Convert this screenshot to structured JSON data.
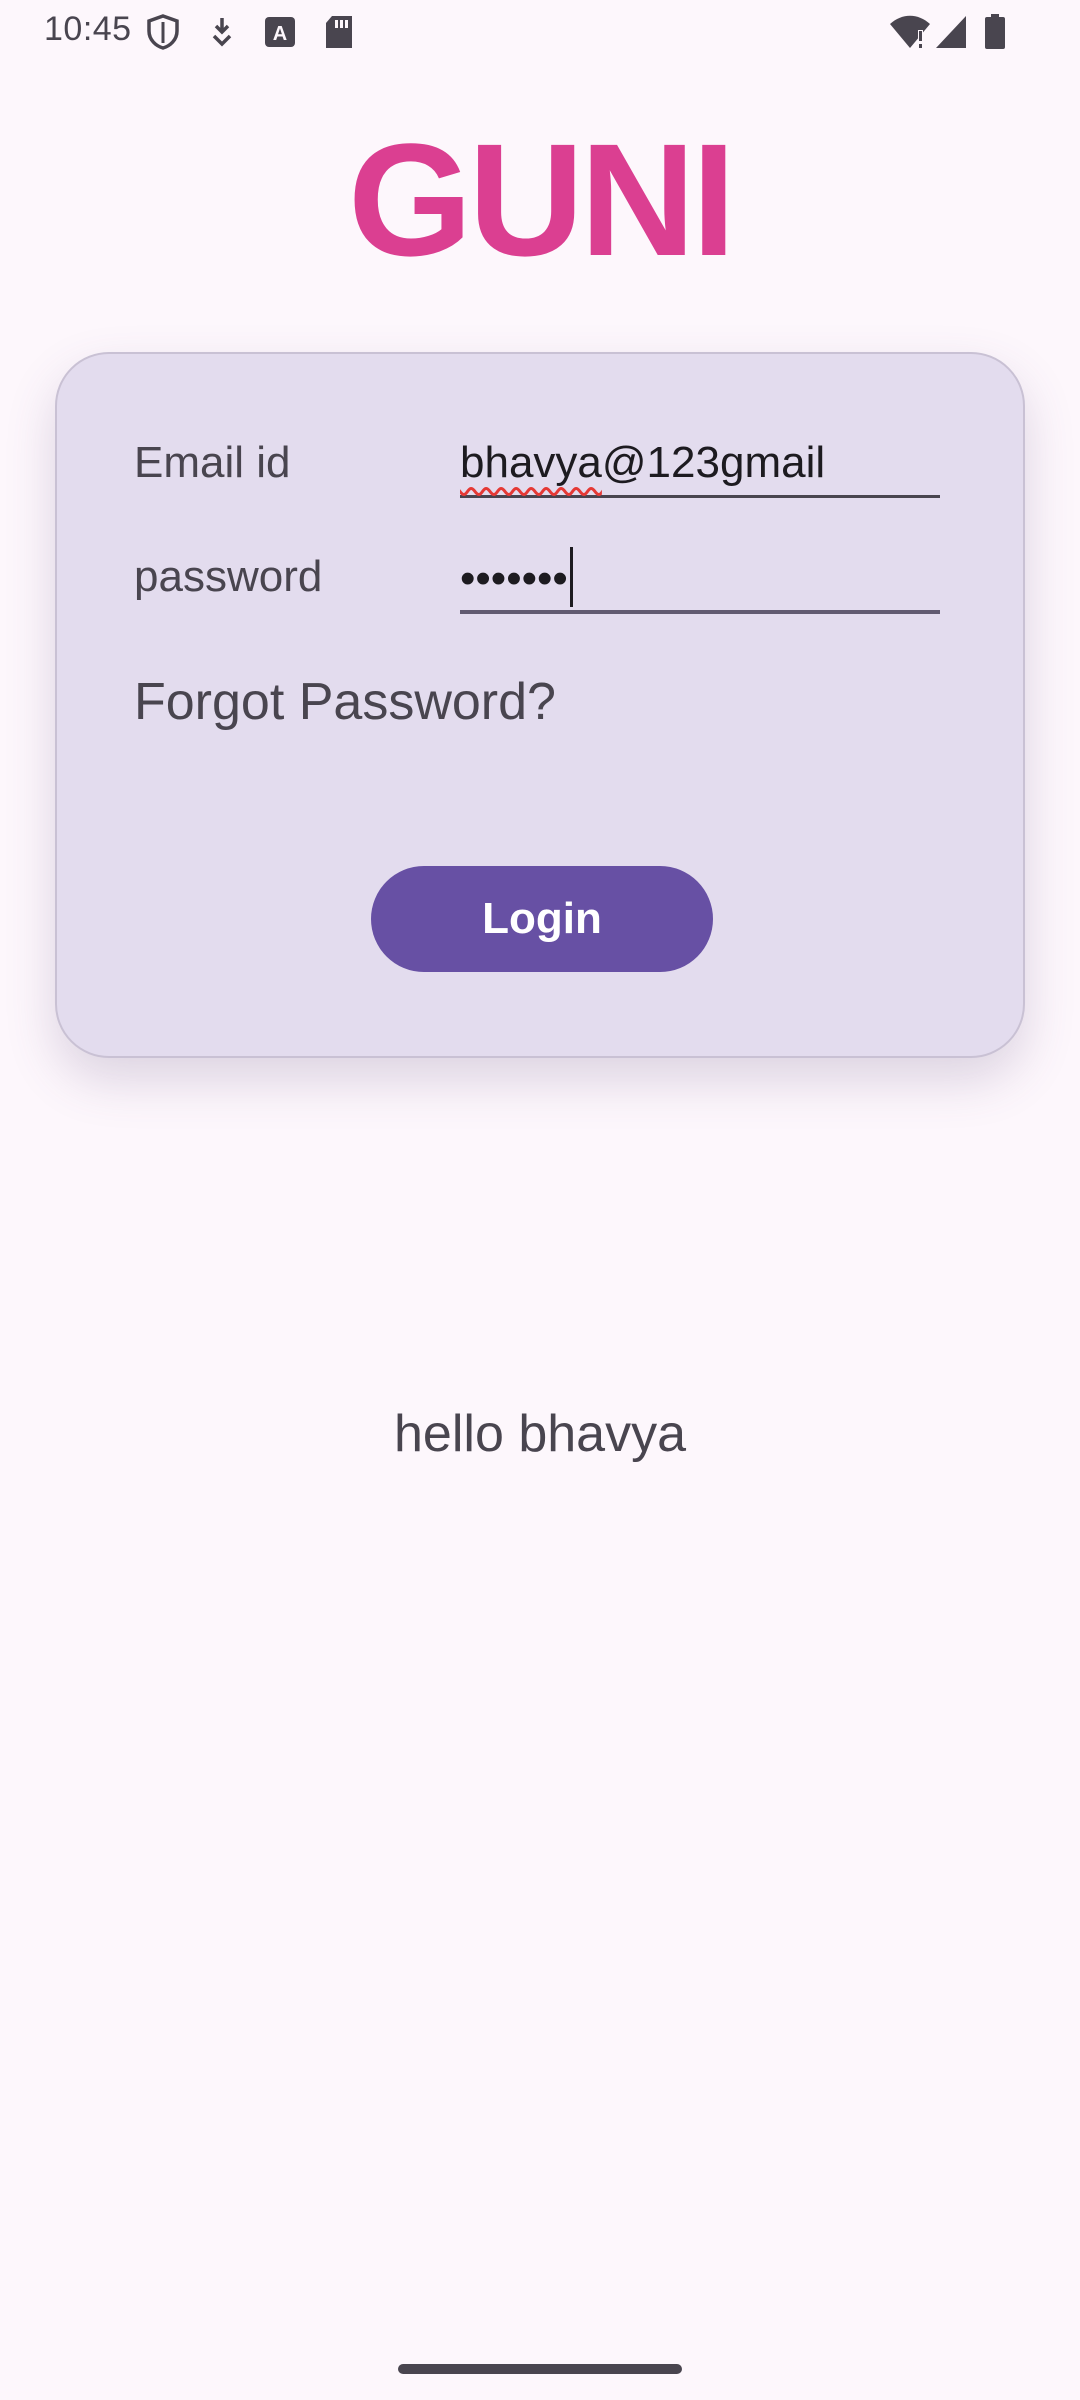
{
  "status_bar": {
    "time": "10:45",
    "icons": [
      "shield-icon",
      "download-icon",
      "text-badge-icon",
      "sd-card-icon",
      "wifi-alert-icon",
      "cellular-signal-icon",
      "battery-icon"
    ],
    "text_badge_letter": "A"
  },
  "app": {
    "logo": "GUNI"
  },
  "login_form": {
    "email_label": "Email id",
    "email_value_underlined": "bhavya",
    "email_value_rest": "@123gmail",
    "password_label": "password",
    "password_masked": "•••••••",
    "forgot_password": "Forgot Password?",
    "login_button": "Login"
  },
  "greeting": "hello bhavya",
  "colors": {
    "background": "#FDF7FC",
    "logo": "#DB3F91",
    "card": "#E3DCEE",
    "primary": "#6750A4",
    "spellcheck": "#E53935"
  }
}
